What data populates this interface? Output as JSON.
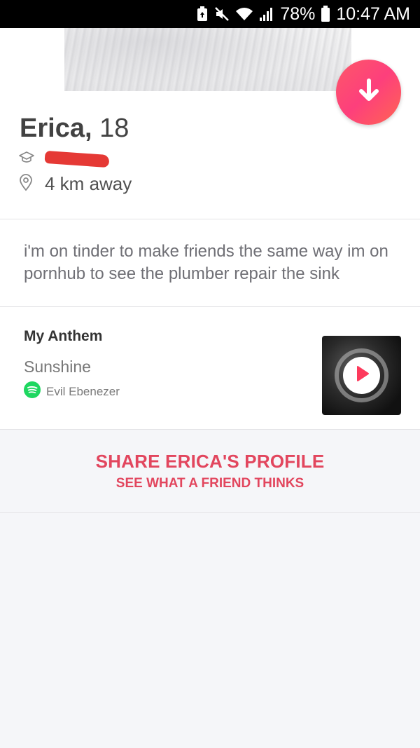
{
  "status_bar": {
    "battery_percent": "78%",
    "time": "10:47 AM",
    "icons": [
      "battery-saver-icon",
      "mute-icon",
      "wifi-icon",
      "signal-icon",
      "battery-icon"
    ]
  },
  "profile": {
    "name": "Erica,",
    "age": "18",
    "distance": "4 km away",
    "bio": "i'm on tinder to make friends the same way im on pornhub to see the plumber repair the sink"
  },
  "anthem": {
    "title": "My Anthem",
    "song": "Sunshine",
    "artist": "Evil Ebenezer"
  },
  "share": {
    "title": "SHARE ERICA'S PROFILE",
    "subtitle": "SEE WHAT A FRIEND THINKS"
  },
  "colors": {
    "accent": "#e2465e",
    "spotify": "#1ed760"
  }
}
